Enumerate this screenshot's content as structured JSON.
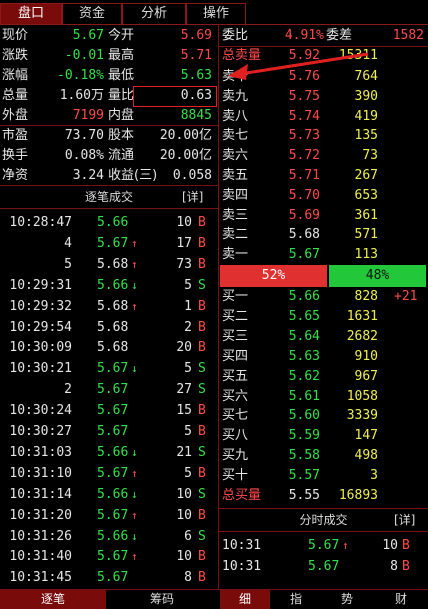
{
  "tabs": [
    {
      "label": "盘口",
      "active": true
    },
    {
      "label": "资金",
      "active": false
    },
    {
      "label": "分析",
      "active": false
    },
    {
      "label": "操作",
      "active": false
    }
  ],
  "quote_left": [
    {
      "l1": "现价",
      "v1": "5.67",
      "c1": "green",
      "l2": "今开",
      "v2": "5.69",
      "c2": "red"
    },
    {
      "l1": "涨跌",
      "v1": "-0.01",
      "c1": "green",
      "l2": "最高",
      "v2": "5.71",
      "c2": "red"
    },
    {
      "l1": "涨幅",
      "v1": "-0.18%",
      "c1": "green",
      "l2": "最低",
      "v2": "5.63",
      "c2": "green"
    },
    {
      "l1": "总量",
      "v1": "1.60万",
      "c1": "white",
      "l2": "量比",
      "v2": "0.63",
      "c2": "white"
    },
    {
      "l1": "外盘",
      "v1": "7199",
      "c1": "red",
      "l2": "内盘",
      "v2": "8845",
      "c2": "green"
    },
    {
      "l1": "市盈",
      "v1": "73.70",
      "c1": "white",
      "l2": "股本",
      "v2": "20.00亿",
      "c2": "white"
    },
    {
      "l1": "换手",
      "v1": "0.08%",
      "c1": "white",
      "l2": "流通",
      "v2": "20.00亿",
      "c2": "white"
    },
    {
      "l1": "净资",
      "v1": "3.24",
      "c1": "white",
      "l2": "收益(三)",
      "v2": "0.058",
      "c2": "white"
    }
  ],
  "ticks_title": "逐笔成交",
  "ticks_detail": "[详]",
  "ticks": [
    {
      "t": "10:28:47",
      "p": "5.66",
      "pc": "green",
      "ar": "",
      "v": "10",
      "s": "B"
    },
    {
      "t": "4",
      "p": "5.67",
      "pc": "green",
      "ar": "↑",
      "v": "17",
      "s": "B"
    },
    {
      "t": "5",
      "p": "5.68",
      "pc": "white",
      "ar": "↑",
      "v": "73",
      "s": "B"
    },
    {
      "t": "10:29:31",
      "p": "5.66",
      "pc": "green",
      "ar": "↓",
      "v": "5",
      "s": "S"
    },
    {
      "t": "10:29:32",
      "p": "5.68",
      "pc": "white",
      "ar": "↑",
      "v": "1",
      "s": "B"
    },
    {
      "t": "10:29:54",
      "p": "5.68",
      "pc": "white",
      "ar": "",
      "v": "2",
      "s": "B"
    },
    {
      "t": "10:30:09",
      "p": "5.68",
      "pc": "white",
      "ar": "",
      "v": "20",
      "s": "B"
    },
    {
      "t": "10:30:21",
      "p": "5.67",
      "pc": "green",
      "ar": "↓",
      "v": "5",
      "s": "S"
    },
    {
      "t": "2",
      "p": "5.67",
      "pc": "green",
      "ar": "",
      "v": "27",
      "s": "S"
    },
    {
      "t": "10:30:24",
      "p": "5.67",
      "pc": "green",
      "ar": "",
      "v": "15",
      "s": "B"
    },
    {
      "t": "10:30:27",
      "p": "5.67",
      "pc": "green",
      "ar": "",
      "v": "5",
      "s": "B"
    },
    {
      "t": "10:31:03",
      "p": "5.66",
      "pc": "green",
      "ar": "↓",
      "v": "21",
      "s": "S"
    },
    {
      "t": "10:31:10",
      "p": "5.67",
      "pc": "green",
      "ar": "↑",
      "v": "5",
      "s": "B"
    },
    {
      "t": "10:31:14",
      "p": "5.66",
      "pc": "green",
      "ar": "↓",
      "v": "10",
      "s": "S"
    },
    {
      "t": "10:31:20",
      "p": "5.67",
      "pc": "green",
      "ar": "↑",
      "v": "10",
      "s": "B"
    },
    {
      "t": "10:31:26",
      "p": "5.66",
      "pc": "green",
      "ar": "↓",
      "v": "6",
      "s": "S"
    },
    {
      "t": "10:31:40",
      "p": "5.67",
      "pc": "green",
      "ar": "↑",
      "v": "10",
      "s": "B"
    },
    {
      "t": "10:31:45",
      "p": "5.67",
      "pc": "green",
      "ar": "",
      "v": "8",
      "s": "B"
    }
  ],
  "weibi": {
    "label": "委比",
    "value": "4.91%",
    "diff_label": "委差",
    "diff_value": "1582"
  },
  "sell_total": {
    "label": "总卖量",
    "price": "5.92",
    "vol": "15311"
  },
  "sells": [
    {
      "label": "卖十",
      "price": "5.76",
      "vol": "764"
    },
    {
      "label": "卖九",
      "price": "5.75",
      "vol": "390"
    },
    {
      "label": "卖八",
      "price": "5.74",
      "vol": "419"
    },
    {
      "label": "卖七",
      "price": "5.73",
      "vol": "135"
    },
    {
      "label": "卖六",
      "price": "5.72",
      "vol": "73"
    },
    {
      "label": "卖五",
      "price": "5.71",
      "vol": "267"
    },
    {
      "label": "卖四",
      "price": "5.70",
      "vol": "653"
    },
    {
      "label": "卖三",
      "price": "5.69",
      "vol": "361"
    },
    {
      "label": "卖二",
      "price": "5.68",
      "vol": "571"
    },
    {
      "label": "卖一",
      "price": "5.67",
      "vol": "113"
    }
  ],
  "ratio": {
    "left": "52%",
    "right": "48%",
    "left_fraction": 0.52
  },
  "buys": [
    {
      "label": "买一",
      "price": "5.66",
      "vol": "828",
      "extra": "+21"
    },
    {
      "label": "买二",
      "price": "5.65",
      "vol": "1631",
      "extra": ""
    },
    {
      "label": "买三",
      "price": "5.64",
      "vol": "2682",
      "extra": ""
    },
    {
      "label": "买四",
      "price": "5.63",
      "vol": "910",
      "extra": ""
    },
    {
      "label": "买五",
      "price": "5.62",
      "vol": "967",
      "extra": ""
    },
    {
      "label": "买六",
      "price": "5.61",
      "vol": "1058",
      "extra": ""
    },
    {
      "label": "买七",
      "price": "5.60",
      "vol": "3339",
      "extra": ""
    },
    {
      "label": "买八",
      "price": "5.59",
      "vol": "147",
      "extra": ""
    },
    {
      "label": "买九",
      "price": "5.58",
      "vol": "498",
      "extra": ""
    },
    {
      "label": "买十",
      "price": "5.57",
      "vol": "3",
      "extra": ""
    }
  ],
  "buy_total": {
    "label": "总买量",
    "price": "5.55",
    "vol": "16893"
  },
  "minute_title": "分时成交",
  "minute_detail": "[详]",
  "minute": [
    {
      "t": "10:31",
      "p": "5.67",
      "ar": "↑",
      "v": "10",
      "s": "B"
    },
    {
      "t": "10:31",
      "p": "5.67",
      "ar": "",
      "v": "8",
      "s": "B"
    }
  ],
  "bottom_left": [
    {
      "label": "逐笔",
      "active": true
    },
    {
      "label": "筹码",
      "active": false
    }
  ],
  "bottom_right": [
    {
      "label": "细",
      "active": true
    },
    {
      "label": "指",
      "active": false
    },
    {
      "label": "势",
      "active": false
    },
    {
      "label": "财",
      "active": false
    }
  ],
  "colors": {
    "red": "#ff4a4a",
    "green": "#33e14a",
    "accent": "#7a0b0b",
    "annotation": "#e02020"
  }
}
